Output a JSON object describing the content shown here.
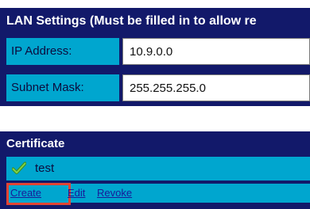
{
  "lan_settings": {
    "title": "LAN Settings (Must be filled in to allow re",
    "fields": [
      {
        "label": "IP Address:",
        "value": "10.9.0.0"
      },
      {
        "label": "Subnet Mask:",
        "value": "255.255.255.0"
      }
    ]
  },
  "certificate": {
    "title": "Certificate",
    "item_name": "test",
    "item_icon": "checkmark-icon",
    "actions": {
      "create": "Create",
      "edit": "Edit",
      "revoke": "Revoke"
    },
    "highlight_color": "#e24433"
  },
  "colors": {
    "panel_bg": "#12196a",
    "row_bg": "#00a6cf",
    "check_green": "#5cb82a"
  }
}
